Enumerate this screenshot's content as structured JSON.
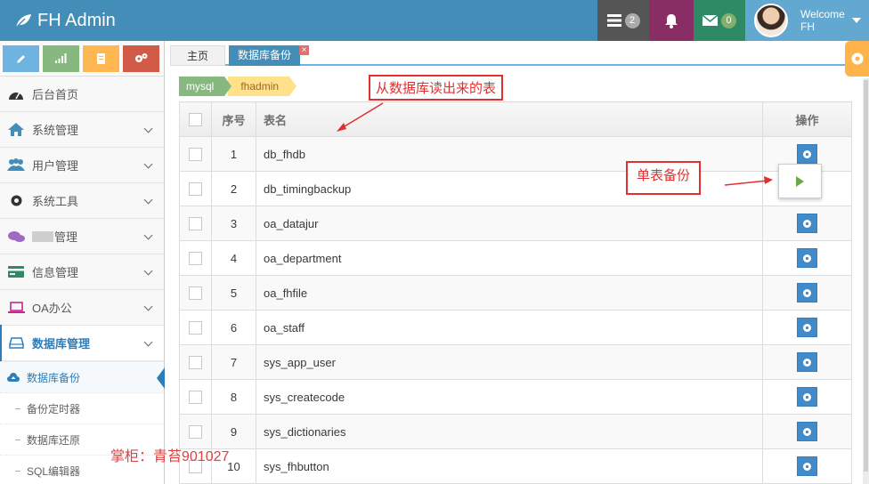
{
  "navbar": {
    "brand": "FH Admin",
    "tasks_count": "2",
    "messages_count": "0",
    "welcome": "Welcome",
    "username": "FH"
  },
  "sidebar": {
    "items": [
      {
        "label": "后台首页",
        "icon": "tachometer-icon"
      },
      {
        "label": "系统管理",
        "icon": "home-icon"
      },
      {
        "label": "用户管理",
        "icon": "users-icon"
      },
      {
        "label": "系统工具",
        "icon": "cog-icon"
      },
      {
        "label": "管理",
        "icon": "comments-icon"
      },
      {
        "label": "信息管理",
        "icon": "credit-card-icon"
      },
      {
        "label": "OA办公",
        "icon": "laptop-icon"
      },
      {
        "label": "数据库管理",
        "icon": "hdd-icon"
      }
    ],
    "sub_items": [
      {
        "label": "数据库备份"
      },
      {
        "label": "备份定时器"
      },
      {
        "label": "数据库还原"
      },
      {
        "label": "SQL编辑器"
      }
    ]
  },
  "tabs": {
    "home": "主页",
    "backup": "数据库备份",
    "close": "×"
  },
  "breadcrumb": {
    "db_type": "mysql",
    "db_name": "fhadmin"
  },
  "table": {
    "headers": {
      "no": "序号",
      "name": "表名",
      "op": "操作"
    },
    "rows": [
      {
        "no": "1",
        "name": "db_fhdb"
      },
      {
        "no": "2",
        "name": "db_timingbackup"
      },
      {
        "no": "3",
        "name": "oa_datajur"
      },
      {
        "no": "4",
        "name": "oa_department"
      },
      {
        "no": "5",
        "name": "oa_fhfile"
      },
      {
        "no": "6",
        "name": "oa_staff"
      },
      {
        "no": "7",
        "name": "sys_app_user"
      },
      {
        "no": "8",
        "name": "sys_createcode"
      },
      {
        "no": "9",
        "name": "sys_dictionaries"
      },
      {
        "no": "10",
        "name": "sys_fhbutton"
      }
    ]
  },
  "annotations": {
    "read_from_db": "从数据库读出来的表",
    "single_backup": "单表备份"
  },
  "watermark": "掌柜：青苔901027",
  "colors": {
    "navbar": "#438eb9",
    "annotation": "#e03030",
    "primary_button": "#428bca"
  }
}
